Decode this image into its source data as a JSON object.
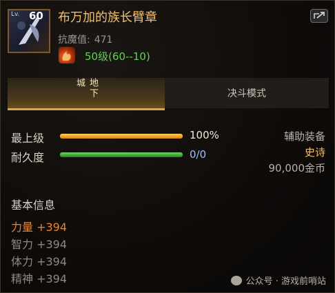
{
  "item": {
    "level_prefix": "Lv.",
    "level": "60",
    "name": "布万加的族长臂章",
    "main_stat_label": "抗魔值:",
    "main_stat_value": "471",
    "enhance_text": "50级(60--10)"
  },
  "tabs": [
    {
      "label": "地下城",
      "active": true
    },
    {
      "label": "决斗模式",
      "active": false
    }
  ],
  "bars": [
    {
      "label": "最上级",
      "value_text": "100%",
      "fill": 1.0,
      "color": "#f3a21b"
    },
    {
      "label": "耐久度",
      "value_text": "0/0",
      "fill": 1.0,
      "color": "#2fb72a"
    }
  ],
  "meta": {
    "type": "辅助装备",
    "rarity": "史诗",
    "price": "90,000金币"
  },
  "section_title": "基本信息",
  "attributes": [
    {
      "text": "力量 +394",
      "highlight": true
    },
    {
      "text": "智力 +394",
      "highlight": false
    },
    {
      "text": "体力 +394",
      "highlight": false
    },
    {
      "text": "精神 +394",
      "highlight": false
    }
  ],
  "watermark": "公众号 · 游戏前哨站",
  "colors": {
    "title": "#f1c06b",
    "rarity": "#f1c06b",
    "enhance": "#62d05a",
    "highlight_attr": "#f0832a",
    "bar_value": "#9cc1ff"
  },
  "icons": [
    "item-icon",
    "share-icon",
    "enhance-flame-icon",
    "wechat-icon"
  ]
}
